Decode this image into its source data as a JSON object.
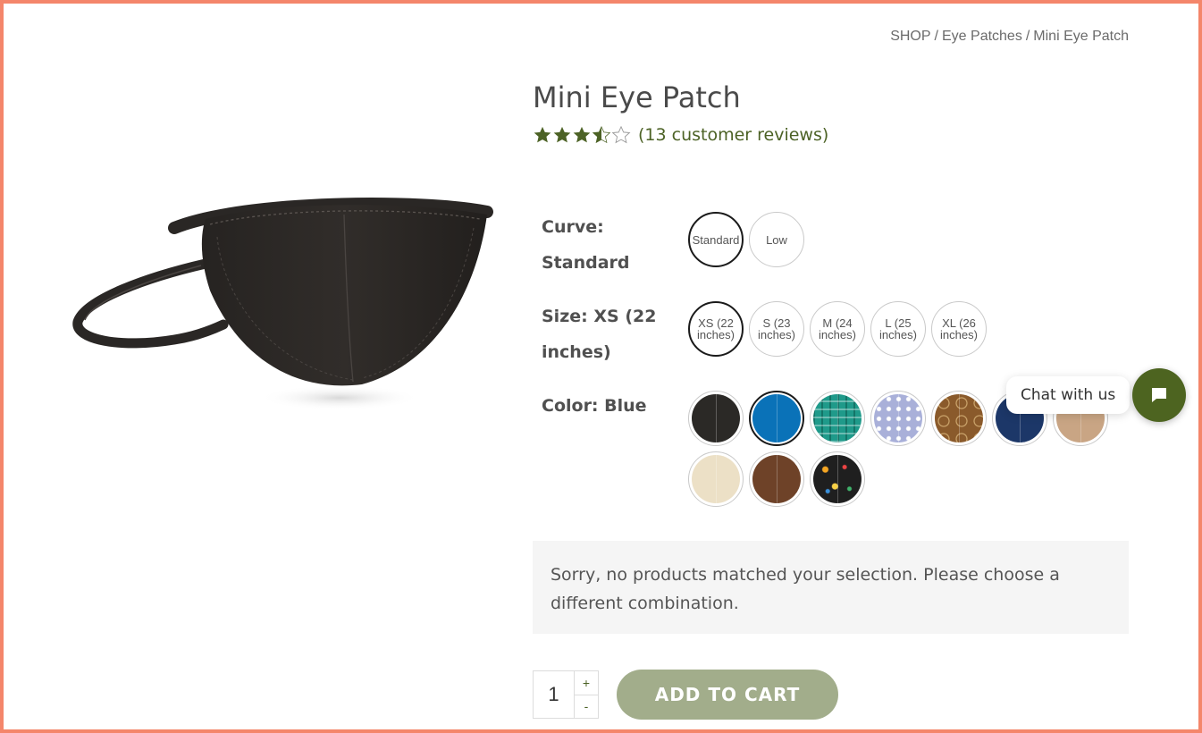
{
  "breadcrumb": {
    "shop": "SHOP",
    "category": "Eye Patches",
    "current": "Mini Eye Patch",
    "separator": "/"
  },
  "product": {
    "title": "Mini Eye Patch",
    "rating": 3.5,
    "rating_max": 5,
    "reviews_text": "(13 customer reviews)"
  },
  "options": {
    "curve": {
      "label": "Curve:",
      "selected": "Standard",
      "values": [
        "Standard",
        "Low"
      ]
    },
    "size": {
      "label": "Size:",
      "selected": "XS (22 inches)",
      "values": [
        "XS (22 inches)",
        "S (23 inches)",
        "M (24 inches)",
        "L (25 inches)",
        "XL (26 inches)"
      ]
    },
    "color": {
      "label": "Color:",
      "selected": "Blue",
      "swatches": [
        {
          "name": "black-swatch",
          "color": "#2b2926"
        },
        {
          "name": "blue-swatch",
          "color": "#0a72b8"
        },
        {
          "name": "teal-plaid-swatch",
          "color": "#1f9a8a"
        },
        {
          "name": "lavender-dots-swatch",
          "color": "#a9b0d9"
        },
        {
          "name": "brown-paisley-swatch",
          "color": "#8a5a2b"
        },
        {
          "name": "navy-swatch",
          "color": "#1c3768"
        },
        {
          "name": "tan-swatch",
          "color": "#c9a584"
        },
        {
          "name": "cream-swatch",
          "color": "#ece0c6"
        },
        {
          "name": "brown-swatch",
          "color": "#6e4228"
        },
        {
          "name": "confetti-swatch",
          "color": "#1f1f1f"
        }
      ]
    }
  },
  "notice": "Sorry, no products matched your selection. Please choose a different combination.",
  "cart": {
    "quantity": "1",
    "plus": "+",
    "minus": "-",
    "button_label": "ADD TO CART"
  },
  "chat": {
    "label": "Chat with us"
  },
  "colors": {
    "accent": "#4c6225",
    "button": "#a2ad8b",
    "frame": "#f4866b"
  }
}
